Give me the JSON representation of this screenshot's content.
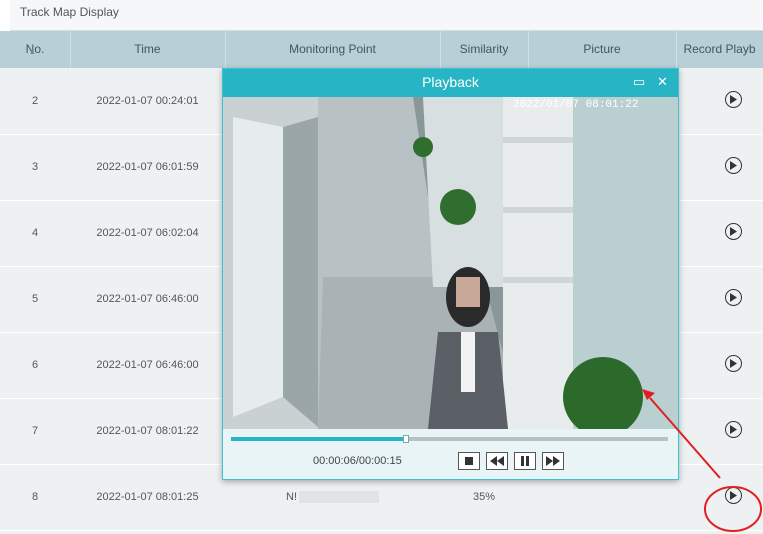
{
  "tab": {
    "label": "Track Map Display"
  },
  "table": {
    "headers": [
      "No.",
      "Time",
      "Monitoring Point",
      "Similarity",
      "Picture",
      "Record Playb"
    ],
    "rows": [
      {
        "no": "2",
        "time": "2022-01-07 00:24:01",
        "monitoring": "",
        "similarity": ""
      },
      {
        "no": "3",
        "time": "2022-01-07 06:01:59",
        "monitoring": "",
        "similarity": ""
      },
      {
        "no": "4",
        "time": "2022-01-07 06:02:04",
        "monitoring": "",
        "similarity": ""
      },
      {
        "no": "5",
        "time": "2022-01-07 06:46:00",
        "monitoring": "",
        "similarity": ""
      },
      {
        "no": "6",
        "time": "2022-01-07 06:46:00",
        "monitoring": "",
        "similarity": ""
      },
      {
        "no": "7",
        "time": "2022-01-07 08:01:22",
        "monitoring": "",
        "similarity": ""
      },
      {
        "no": "8",
        "time": "2022-01-07 08:01:25",
        "monitoring": "N!",
        "similarity": "35%"
      }
    ]
  },
  "dialog": {
    "title": "Playback",
    "timestamp": "2022/01/07 08:01:22",
    "time_display": "00:00:06/00:00:15",
    "progress_fraction": 0.4
  },
  "colors": {
    "header": "#b8cfd8",
    "accent": "#27b4c5",
    "annotation": "#e02020"
  }
}
